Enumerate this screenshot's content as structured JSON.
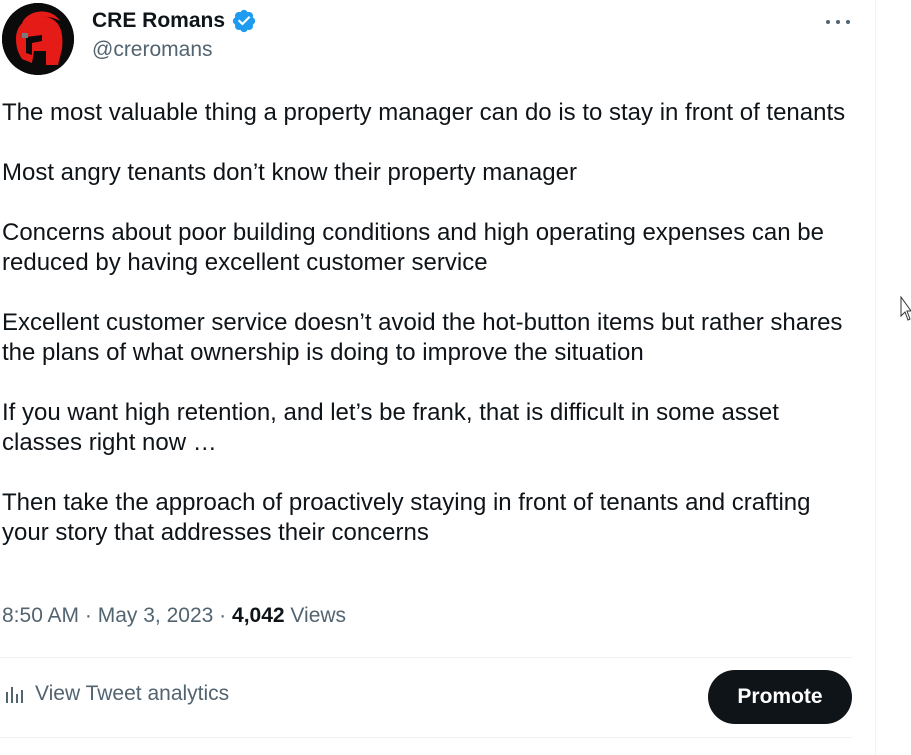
{
  "author": {
    "display_name": "CRE Romans",
    "handle": "@creromans",
    "verified": true,
    "verified_color": "#1d9bf0",
    "avatar_icon": "spartan-helmet-logo",
    "avatar_colors": {
      "helmet": "#e41b17",
      "background": "#0b0b0b"
    }
  },
  "tweet": {
    "paragraphs": [
      "The most valuable thing a property manager can do is to stay in front of tenants",
      "Most angry tenants don’t know their property manager",
      "Concerns about poor building conditions and high operating expenses can be reduced by having excellent customer service",
      "Excellent customer service doesn’t avoid the hot-button items but rather shares the plans of what ownership is doing to improve the situation",
      "If you want high retention, and let’s be frank, that is difficult in some asset classes right now …",
      "Then take the approach of proactively staying in front of tenants and crafting your story that addresses their concerns"
    ],
    "time": "8:50 AM",
    "separator": "·",
    "date": "May 3, 2023",
    "views_count": "4,042",
    "views_label": "Views"
  },
  "actions": {
    "analytics_label": "View Tweet analytics",
    "analytics_icon": "bar-chart-icon",
    "promote_label": "Promote",
    "more_icon": "more-options-icon"
  },
  "colors": {
    "text_primary": "#0f1419",
    "text_secondary": "#536471",
    "divider": "#eff3f4",
    "button_bg": "#0f1419",
    "button_text": "#ffffff"
  }
}
